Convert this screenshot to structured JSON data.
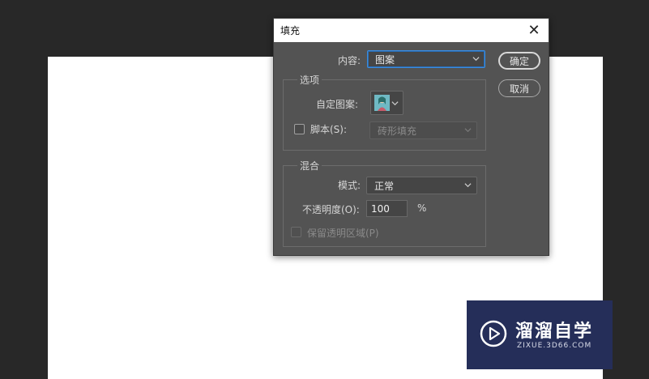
{
  "dialog": {
    "title": "填充",
    "content_label": "内容:",
    "content_value": "图案",
    "ok_label": "确定",
    "cancel_label": "取消",
    "options": {
      "group_label": "选项",
      "custom_pattern_label": "自定图案:",
      "script_label": "脚本(S):",
      "script_checked": false,
      "script_value": "砖形填充"
    },
    "blending": {
      "group_label": "混合",
      "mode_label": "模式:",
      "mode_value": "正常",
      "opacity_label": "不透明度(O):",
      "opacity_value": "100",
      "opacity_unit": "%",
      "preserve_label": "保留透明区域(P)",
      "preserve_checked": false
    }
  },
  "watermark": {
    "title": "溜溜自学",
    "subtitle": "ZIXUE.3D66.COM"
  },
  "colors": {
    "workspace": "#282828",
    "dialog_bg": "#535353",
    "focus_border": "#3b8cde",
    "watermark_bg": "#252e59"
  }
}
